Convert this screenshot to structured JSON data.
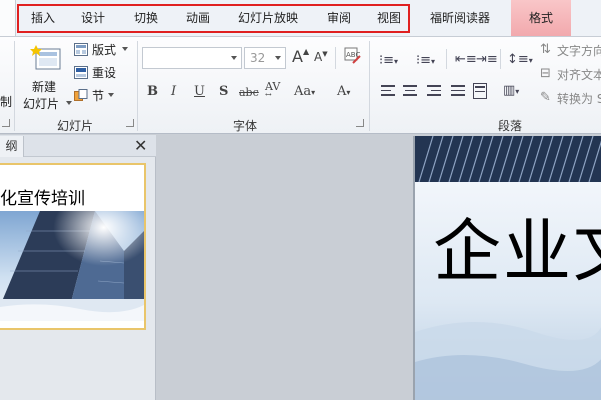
{
  "tabs": [
    "插入",
    "设计",
    "切换",
    "动画",
    "幻灯片放映",
    "审阅",
    "视图",
    "福昕阅读器",
    "格式"
  ],
  "ribbon": {
    "slides_group": {
      "new_slide_line1": "新建",
      "new_slide_line2": "幻灯片",
      "layout": "版式",
      "reset": "重设",
      "section": "节",
      "label": "幻灯片"
    },
    "font_group": {
      "font_size": "32",
      "label": "字体"
    },
    "paragraph_group": {
      "text_direction": "文字方向",
      "align_text": "对齐文本",
      "convert": "转换为 S",
      "label": "段落"
    },
    "left_edge_char": "制"
  },
  "outline_pane": {
    "tab_label": "纲",
    "thumbnail_title": "化宣传培训"
  },
  "slide": {
    "title": "企业文"
  },
  "colors": {
    "highlight_box": "#e02020",
    "format_tab": "#f4b4b7",
    "thumb_selection": "#e9c56a"
  }
}
